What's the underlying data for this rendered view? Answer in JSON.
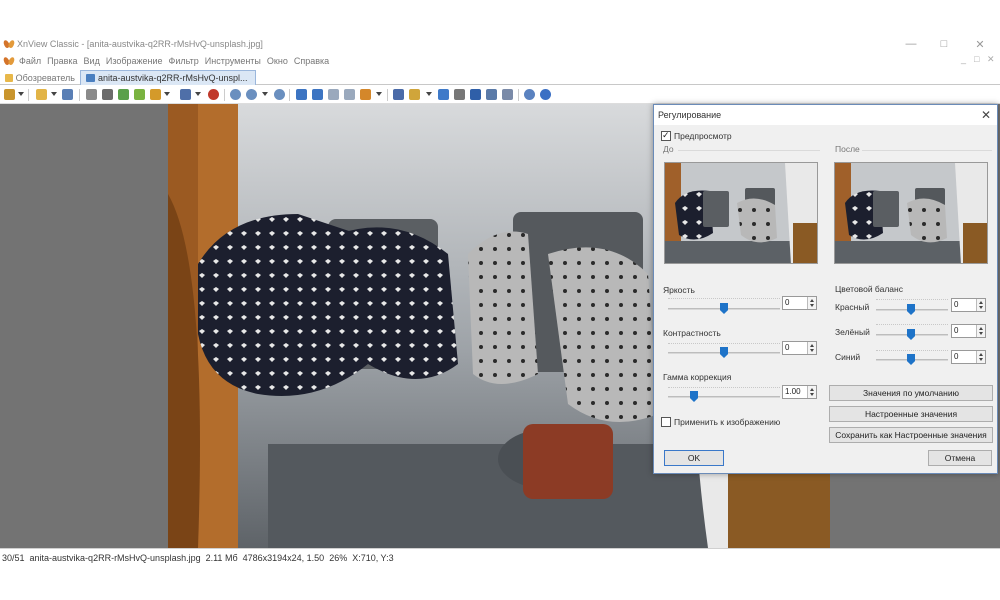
{
  "window": {
    "title": "XnView Classic - [anita-austvika-q2RR-rMsHvQ-unsplash.jpg]",
    "minimize": "—",
    "maximize": "□",
    "close": "✕"
  },
  "menu": {
    "items": [
      "Файл",
      "Правка",
      "Вид",
      "Изображение",
      "Фильтр",
      "Инструменты",
      "Окно",
      "Справка"
    ],
    "mdi_controls": [
      "_",
      "□",
      "✕"
    ]
  },
  "tabs": [
    {
      "label": "Обозреватель",
      "active": false
    },
    {
      "label": "anita-austvika-q2RR-rMsHvQ-unspl...",
      "active": true
    }
  ],
  "toolbar": {
    "icons": [
      "wand-icon",
      "folder-icon",
      "save-icon",
      "scan-icon",
      "print-icon",
      "rotate-icon",
      "zoom-in-icon",
      "zoom-out-icon",
      "prev-icon",
      "next-icon",
      "fullscreen-icon",
      "slideshow-icon",
      "settings-icon",
      "help-icon"
    ]
  },
  "statusbar": {
    "index": "30/51",
    "filename": "anita-austvika-q2RR-rMsHvQ-unsplash.jpg",
    "filesize": "2.11 Мб",
    "dimensions": "4786x3194x24, 1.50",
    "zoom": "26%",
    "coords": "X:710, Y:3"
  },
  "dialog": {
    "title": "Регулирование",
    "preview_label": "Предпросмотр",
    "preview_checked": true,
    "before_label": "До",
    "after_label": "После",
    "brightness": {
      "label": "Яркость",
      "value": "0"
    },
    "contrast": {
      "label": "Контрастность",
      "value": "0"
    },
    "gamma": {
      "label": "Гамма коррекция",
      "value": "1.00"
    },
    "color_balance": {
      "label": "Цветовой баланс",
      "red": {
        "label": "Красный",
        "value": "0"
      },
      "green": {
        "label": "Зелёный",
        "value": "0"
      },
      "blue": {
        "label": "Синий",
        "value": "0"
      }
    },
    "apply_label": "Применить к изображению",
    "apply_checked": false,
    "defaults_button": "Значения по умолчанию",
    "custom_button": "Настроенные значения",
    "save_custom_button": "Сохранить как Настроенные значения",
    "ok_button": "OK",
    "cancel_button": "Отмена"
  },
  "colors": {
    "accent": "#1e73c8",
    "viewer_bg": "#737373",
    "tab_active": "#dbe7f5"
  }
}
